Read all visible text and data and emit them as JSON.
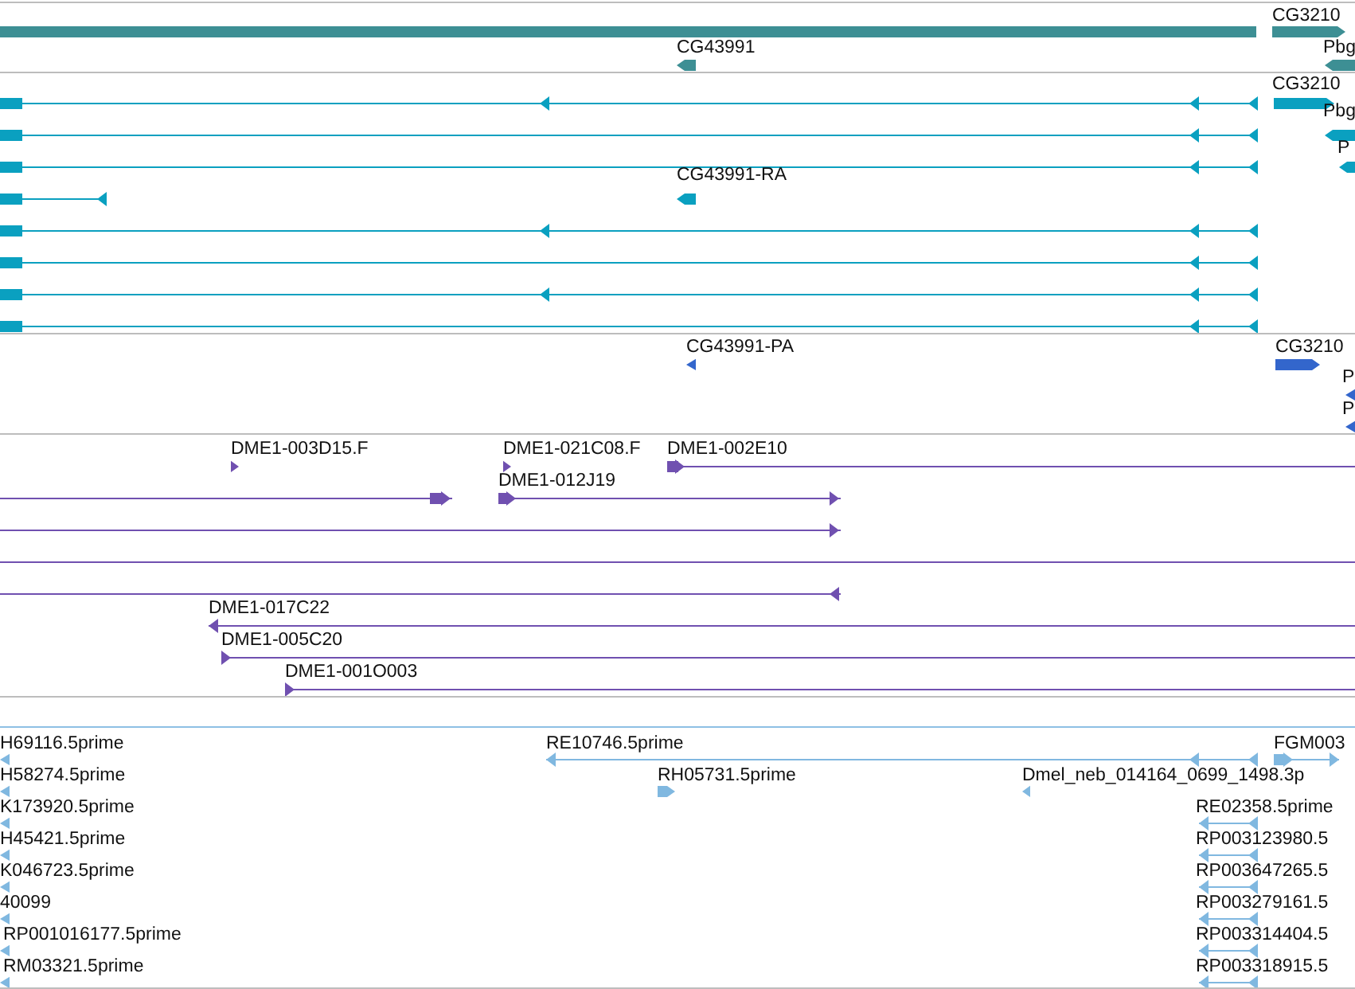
{
  "tracks": [
    {
      "color": "#3d8f94",
      "features": [
        {
          "kind": "bar"
        },
        {
          "kind": "bar",
          "label": "CG3210",
          "forward": true
        },
        {
          "kind": "bar",
          "label": "CG43991",
          "forward": false
        },
        {
          "kind": "bar",
          "label": "Pbg",
          "forward": false
        }
      ]
    },
    {
      "color": "#0aa0c0",
      "features": [
        {
          "kind": "line",
          "forward": false
        },
        {
          "kind": "line",
          "forward": false
        },
        {
          "kind": "line",
          "forward": false
        },
        {
          "kind": "line",
          "forward": false
        },
        {
          "kind": "line",
          "forward": false
        },
        {
          "kind": "line",
          "forward": false
        },
        {
          "kind": "line",
          "forward": false
        },
        {
          "kind": "line",
          "forward": false
        },
        {
          "kind": "bar",
          "label": "CG3210",
          "forward": true
        },
        {
          "kind": "bar",
          "label": "Pbg",
          "forward": false
        },
        {
          "kind": "bar",
          "label": "P",
          "forward": false
        },
        {
          "kind": "bar",
          "label": "CG43991-RA",
          "forward": false
        }
      ]
    },
    {
      "color": "#3366cc",
      "features": [
        {
          "kind": "tick",
          "label": "CG43991-PA",
          "forward": false
        },
        {
          "kind": "bar",
          "label": "CG3210",
          "forward": true
        },
        {
          "kind": "tick",
          "label": "P",
          "forward": false
        },
        {
          "kind": "tick",
          "label": "P",
          "forward": false
        }
      ]
    },
    {
      "color": "#7050b0",
      "features": [
        {
          "kind": "tick",
          "label": "DME1-003D15.F",
          "forward": true
        },
        {
          "kind": "tick",
          "label": "DME1-021C08.F",
          "forward": true
        },
        {
          "kind": "line",
          "label": "DME1-002E10",
          "forward": true
        },
        {
          "kind": "line",
          "forward": true
        },
        {
          "kind": "line",
          "label": "DME1-012J19",
          "forward": true
        },
        {
          "kind": "line",
          "forward": true
        },
        {
          "kind": "line"
        },
        {
          "kind": "line",
          "forward": false
        },
        {
          "kind": "line",
          "label": "DME1-017C22",
          "forward": false
        },
        {
          "kind": "line",
          "label": "DME1-005C20",
          "forward": true
        },
        {
          "kind": "line",
          "label": "DME1-001O003",
          "forward": true
        }
      ]
    },
    {
      "color": "#80b8e0",
      "features": [
        {
          "kind": "tick",
          "label": "H69116.5prime",
          "forward": false
        },
        {
          "kind": "tick",
          "label": "H58274.5prime",
          "forward": false
        },
        {
          "kind": "tick",
          "label": "K173920.5prime",
          "forward": false
        },
        {
          "kind": "tick",
          "label": "H45421.5prime",
          "forward": false
        },
        {
          "kind": "tick",
          "label": "K046723.5prime",
          "forward": false
        },
        {
          "kind": "tick",
          "label": "40099",
          "forward": false
        },
        {
          "kind": "tick",
          "label": "RP001016177.5prime",
          "forward": false
        },
        {
          "kind": "tick",
          "label": "RM03321.5prime",
          "forward": false
        },
        {
          "kind": "line",
          "label": "RE10746.5prime",
          "forward": false
        },
        {
          "kind": "line",
          "label": "FGM003",
          "forward": true
        },
        {
          "kind": "bar",
          "label": "RH05731.5prime",
          "forward": true
        },
        {
          "kind": "tick",
          "label": "Dmel_neb_014164_0699_1498.3p",
          "forward": false
        },
        {
          "kind": "line",
          "label": "RE02358.5prime",
          "forward": false
        },
        {
          "kind": "line",
          "label": "RP003123980.5",
          "forward": false
        },
        {
          "kind": "line",
          "label": "RP003647265.5",
          "forward": false
        },
        {
          "kind": "line",
          "label": "RP003279161.5",
          "forward": false
        },
        {
          "kind": "line",
          "label": "RP003314404.5",
          "forward": false
        },
        {
          "kind": "line",
          "label": "RP003318915.5",
          "forward": false
        }
      ]
    }
  ]
}
